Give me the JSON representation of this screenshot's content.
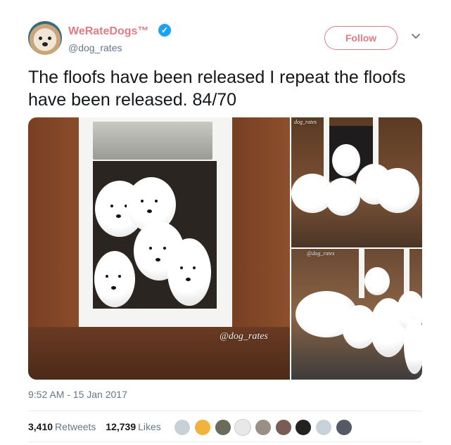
{
  "author": {
    "name": "WeRateDogs™",
    "handle": "@dog_rates",
    "follow_label": "Follow"
  },
  "tweet": {
    "text": "The floofs have been released I repeat the floofs have been released. 84/70",
    "timestamp": "9:52 AM - 15 Jan 2017"
  },
  "media": {
    "watermarks": [
      "@dog_rates",
      "dog_rates",
      "@dog_rates"
    ]
  },
  "stats": {
    "retweets_count": "3,410",
    "retweets_label": "Retweets",
    "likes_count": "12,739",
    "likes_label": "Likes"
  },
  "likers": [
    "avatar-1",
    "avatar-2",
    "avatar-3",
    "avatar-4",
    "avatar-5",
    "avatar-6",
    "avatar-7",
    "avatar-8",
    "avatar-9"
  ],
  "colors": {
    "brand_pink": "#e07b86",
    "verified_blue": "#1da1f2",
    "secondary_text": "#657786"
  }
}
